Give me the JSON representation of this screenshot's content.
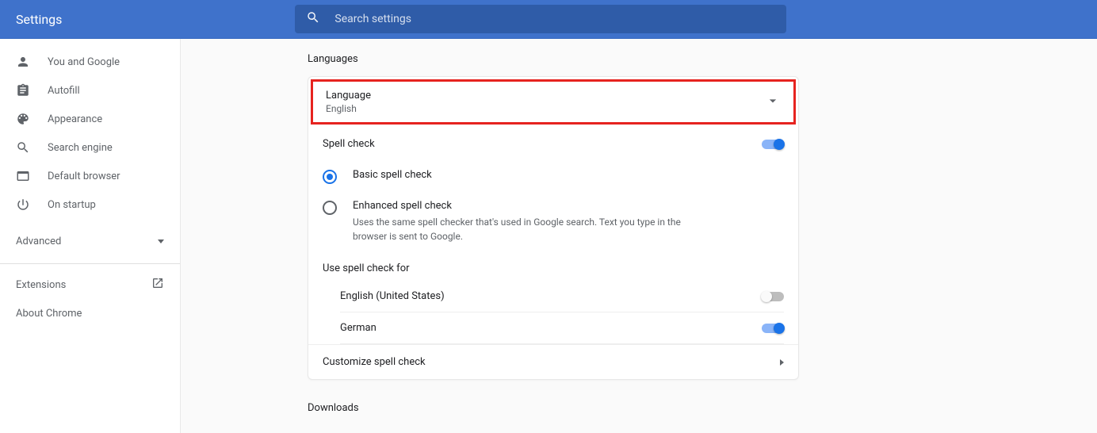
{
  "header": {
    "title": "Settings",
    "search_placeholder": "Search settings"
  },
  "sidebar": {
    "items": [
      {
        "label": "You and Google"
      },
      {
        "label": "Autofill"
      },
      {
        "label": "Appearance"
      },
      {
        "label": "Search engine"
      },
      {
        "label": "Default browser"
      },
      {
        "label": "On startup"
      }
    ],
    "advanced": "Advanced",
    "extensions": "Extensions",
    "about": "About Chrome"
  },
  "main": {
    "languages_title": "Languages",
    "language_label": "Language",
    "language_value": "English",
    "spellcheck_label": "Spell check",
    "basic_label": "Basic spell check",
    "enhanced_label": "Enhanced spell check",
    "enhanced_desc": "Uses the same spell checker that's used in Google search. Text you type in the browser is sent to Google.",
    "use_for_label": "Use spell check for",
    "lang1": "English (United States)",
    "lang2": "German",
    "customize": "Customize spell check",
    "downloads_title": "Downloads"
  }
}
